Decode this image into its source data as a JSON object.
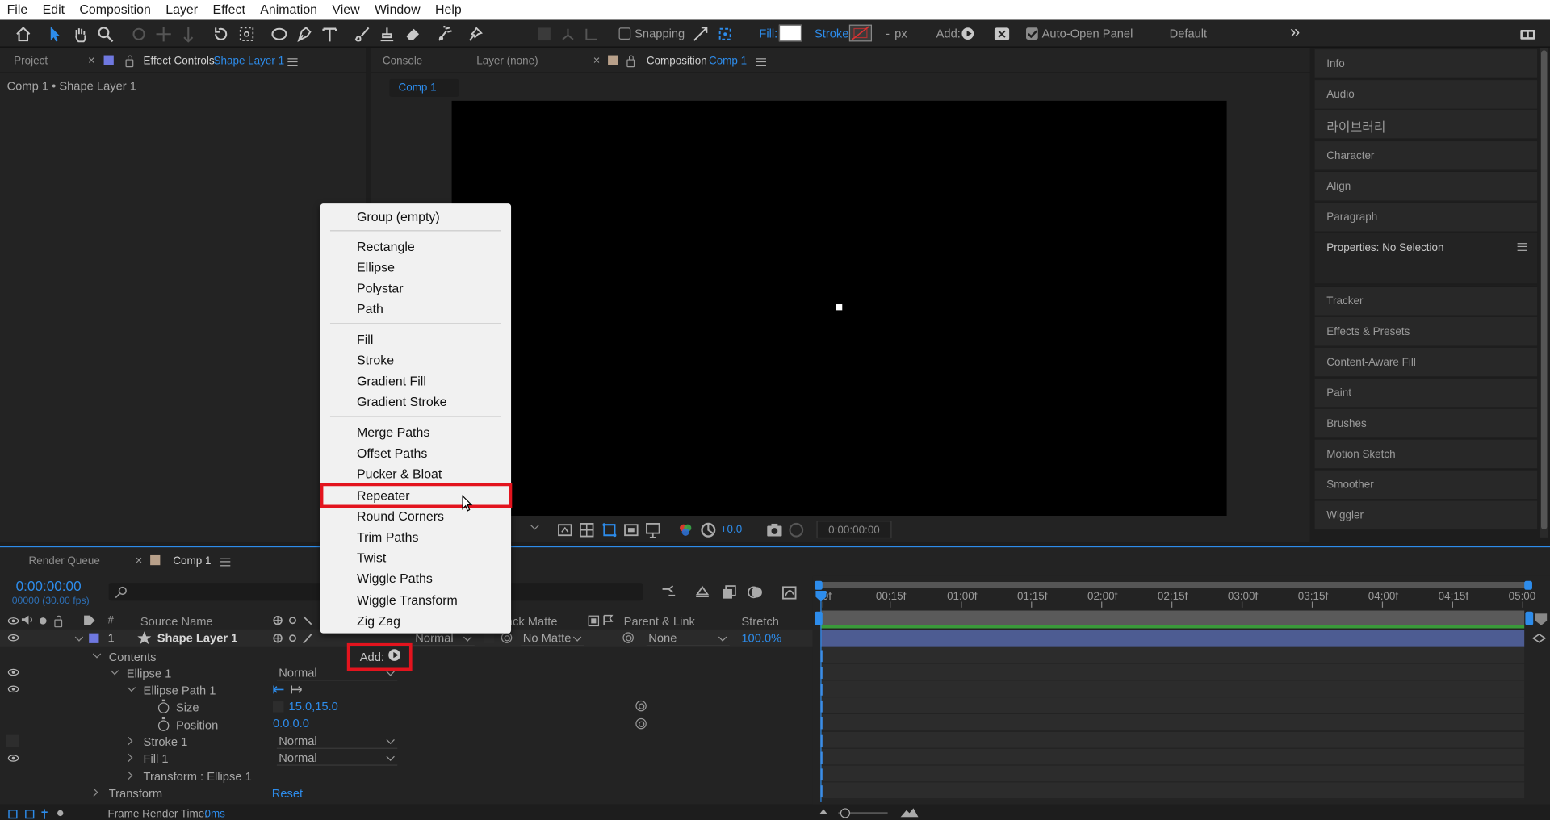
{
  "menu": [
    "File",
    "Edit",
    "Composition",
    "Layer",
    "Effect",
    "Animation",
    "View",
    "Window",
    "Help"
  ],
  "toolbar": {
    "snapping_label": "Snapping",
    "fill_label": "Fill:",
    "stroke_label": "Stroke:",
    "stroke_dash": "-",
    "stroke_unit": "px",
    "add_label": "Add:",
    "auto_open_label": "Auto-Open Panel",
    "workspace": "Default",
    "overflow": "»"
  },
  "left_panel": {
    "tab_project": "Project",
    "tab_effect_controls": "Effect Controls",
    "tab_effect_controls_layer": "Shape Layer 1",
    "breadcrumb": "Comp 1 • Shape Layer 1"
  },
  "viewer": {
    "tab_console": "Console",
    "tab_layer": "Layer (none)",
    "tab_composition": "Composition",
    "tab_composition_name": "Comp 1",
    "subtab": "Comp 1",
    "exposure": "+0.0",
    "timecode": "0:00:00:00"
  },
  "right_panel": {
    "items": [
      "Info",
      "Audio",
      "라이브러리",
      "Character",
      "Align",
      "Paragraph"
    ],
    "properties_title": "Properties: No Selection",
    "items2": [
      "Tracker",
      "Effects & Presets",
      "Content-Aware Fill",
      "Paint",
      "Brushes",
      "Motion Sketch",
      "Smoother",
      "Wiggler"
    ]
  },
  "timeline": {
    "tab_render_queue": "Render Queue",
    "tab_comp": "Comp 1",
    "timecode": "0:00:00:00",
    "frame_info": "00000 (30.00 fps)",
    "search_placeholder": "",
    "col_hash": "#",
    "col_source_name": "Source Name",
    "col_track_matte": "Track Matte",
    "col_parent_link": "Parent & Link",
    "col_stretch": "Stretch",
    "layer_number": "1",
    "layer_name": "Shape Layer 1",
    "layer_mode": "Normal",
    "layer_matte": "No Matte",
    "layer_parent": "None",
    "layer_stretch": "100.0%",
    "contents_label": "Contents",
    "add_label": "Add:",
    "ellipse_group": "Ellipse 1",
    "ellipse_group_mode": "Normal",
    "ellipse_path": "Ellipse Path 1",
    "size_label": "Size",
    "size_value": "15.0,15.0",
    "position_label": "Position",
    "position_value": "0.0,0.0",
    "stroke_label": "Stroke 1",
    "stroke_mode": "Normal",
    "fill_label": "Fill 1",
    "fill_mode": "Normal",
    "transform_ellipse_label": "Transform : Ellipse 1",
    "transform_label": "Transform",
    "reset_label": "Reset",
    "frame_render_label": "Frame Render Time:",
    "frame_render_value": "0ms",
    "ruler": [
      "0f",
      "00:15f",
      "01:00f",
      "01:15f",
      "02:00f",
      "02:15f",
      "03:00f",
      "03:15f",
      "04:00f",
      "04:15f",
      "05:00"
    ]
  },
  "add_menu": {
    "group1": [
      "Group (empty)"
    ],
    "group2": [
      "Rectangle",
      "Ellipse",
      "Polystar",
      "Path"
    ],
    "group3": [
      "Fill",
      "Stroke",
      "Gradient Fill",
      "Gradient Stroke"
    ],
    "group4": [
      "Merge Paths",
      "Offset Paths",
      "Pucker & Bloat",
      "Repeater",
      "Round Corners",
      "Trim Paths",
      "Twist",
      "Wiggle Paths",
      "Wiggle Transform",
      "Zig Zag"
    ],
    "highlighted": "Repeater"
  },
  "colors": {
    "accent_blue": "#2d8ceb",
    "highlight_red": "#e3141e",
    "layer_bar": "#4d5c92",
    "label_swatch": "#6f78e0"
  }
}
